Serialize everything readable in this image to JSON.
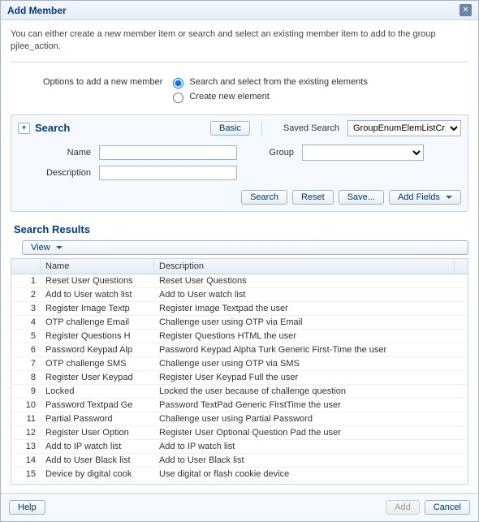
{
  "dialog": {
    "title": "Add Member",
    "intro": "You can either create a new member item or search and select an existing member item to add to the group pjlee_action."
  },
  "options": {
    "label": "Options to add a new member",
    "radio1": "Search and select from the existing elements",
    "radio2": "Create new element"
  },
  "search": {
    "title": "Search",
    "basic_btn": "Basic",
    "saved_label": "Saved Search",
    "saved_value": "GroupEnumElemListCriteria",
    "name_label": "Name",
    "name_value": "",
    "desc_label": "Description",
    "desc_value": "",
    "group_label": "Group",
    "group_value": "",
    "search_btn": "Search",
    "reset_btn": "Reset",
    "save_btn": "Save...",
    "addfields_btn": "Add Fields"
  },
  "results": {
    "title": "Search Results",
    "view_btn": "View",
    "col_blank": "",
    "col_name": "Name",
    "col_desc": "Description",
    "rows": [
      {
        "idx": "1",
        "name": "Reset User Questions",
        "desc": "Reset User Questions"
      },
      {
        "idx": "2",
        "name": "Add to User watch list",
        "desc": "Add to User watch list"
      },
      {
        "idx": "3",
        "name": "Register Image Textp",
        "desc": "Register Image Textpad the user"
      },
      {
        "idx": "4",
        "name": "OTP challenge Email",
        "desc": "Challenge user using OTP via Email"
      },
      {
        "idx": "5",
        "name": "Register Questions H",
        "desc": "Register Questions HTML the user"
      },
      {
        "idx": "6",
        "name": "Password Keypad Alp",
        "desc": "Password Keypad Alpha Turk Generic First-Time the user"
      },
      {
        "idx": "7",
        "name": "OTP challenge SMS",
        "desc": "Challenge user using OTP via SMS"
      },
      {
        "idx": "8",
        "name": "Register User Keypad",
        "desc": "Register User Keypad Full the user"
      },
      {
        "idx": "9",
        "name": "Locked",
        "desc": "Locked the user because of challenge question"
      },
      {
        "idx": "10",
        "name": "Password Textpad Ge",
        "desc": "Password TextPad Generic FirstTime the user"
      },
      {
        "idx": "11",
        "name": "Partial Password",
        "desc": "Challenge user using Partial Password"
      },
      {
        "idx": "12",
        "name": "Register User Option",
        "desc": "Register User Optional Question Pad the user"
      },
      {
        "idx": "13",
        "name": "Add to IP watch list",
        "desc": "Add to IP watch list"
      },
      {
        "idx": "14",
        "name": "Add to User Black list",
        "desc": "Add to User Black list"
      },
      {
        "idx": "15",
        "name": "Device by digital cook",
        "desc": "Use digital or flash cookie device"
      }
    ]
  },
  "footer": {
    "help": "Help",
    "add": "Add",
    "cancel": "Cancel"
  }
}
